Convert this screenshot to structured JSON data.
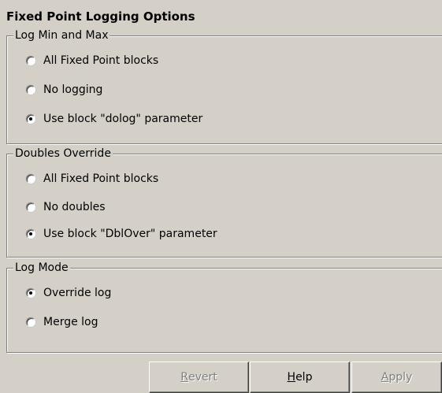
{
  "panel": {
    "title": "Fixed Point Logging Options"
  },
  "groups": [
    {
      "legend": "Log Min and Max",
      "options": [
        {
          "label": "All Fixed Point blocks",
          "selected": false
        },
        {
          "label": "No logging",
          "selected": false
        },
        {
          "label": "Use block \"dolog\" parameter",
          "selected": true
        }
      ]
    },
    {
      "legend": "Doubles Override",
      "options": [
        {
          "label": "All Fixed Point blocks",
          "selected": false
        },
        {
          "label": "No doubles",
          "selected": false
        },
        {
          "label": "Use block \"DblOver\" parameter",
          "selected": true
        }
      ]
    },
    {
      "legend": "Log Mode",
      "options": [
        {
          "label": "Override log",
          "selected": true
        },
        {
          "label": "Merge log",
          "selected": false
        }
      ]
    }
  ],
  "buttons": {
    "revert": {
      "accel": "R",
      "rest": "evert",
      "enabled": false
    },
    "help": {
      "accel": "H",
      "rest": "elp",
      "enabled": true
    },
    "apply": {
      "accel": "A",
      "rest": "pply",
      "enabled": false
    }
  }
}
